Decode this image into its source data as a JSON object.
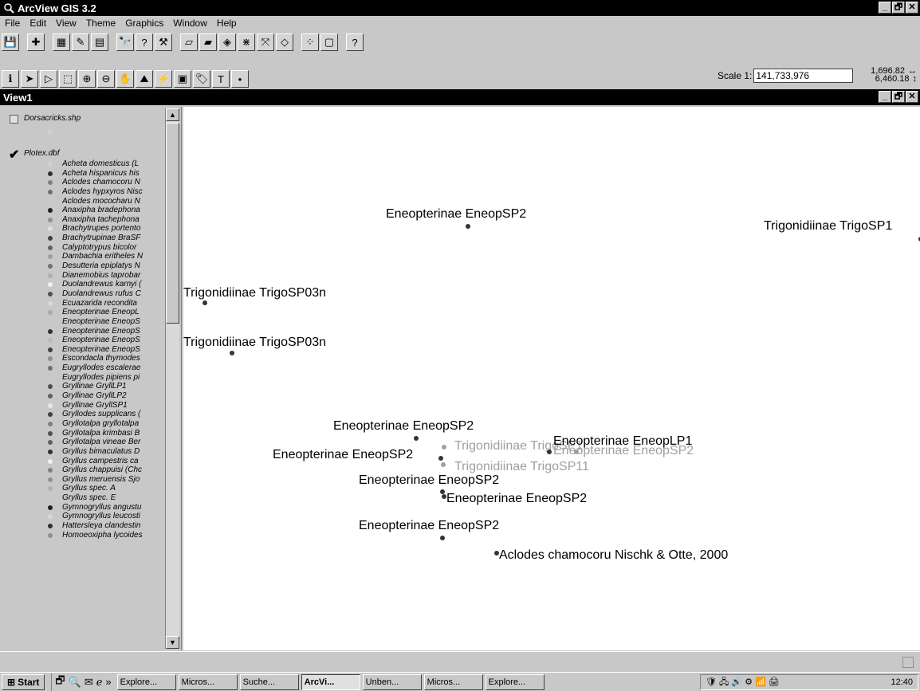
{
  "app": {
    "title": "ArcView GIS 3.2",
    "window_buttons": [
      "_",
      "🗗",
      "✕"
    ]
  },
  "menu": [
    "File",
    "Edit",
    "View",
    "Theme",
    "Graphics",
    "Window",
    "Help"
  ],
  "toolbar_buttons": [
    {
      "icon": "save-icon",
      "glyph": "💾"
    },
    {
      "icon": "add-theme-icon",
      "glyph": "✚"
    },
    {
      "icon": "theme-properties-icon",
      "glyph": "▦"
    },
    {
      "icon": "edit-legend-icon",
      "glyph": "✎"
    },
    {
      "icon": "open-table-icon",
      "glyph": "▤"
    },
    {
      "icon": "find-icon",
      "glyph": "🔭"
    },
    {
      "icon": "query-builder-icon",
      "glyph": "?"
    },
    {
      "icon": "locate-address-icon",
      "glyph": "⚒"
    },
    {
      "icon": "zoom-full-extent-icon",
      "glyph": "▱"
    },
    {
      "icon": "zoom-active-themes-icon",
      "glyph": "▰"
    },
    {
      "icon": "zoom-selected-icon",
      "glyph": "◈"
    },
    {
      "icon": "zoom-in-fixed-icon",
      "glyph": "⋇"
    },
    {
      "icon": "zoom-out-fixed-icon",
      "glyph": "⤧"
    },
    {
      "icon": "zoom-previous-icon",
      "glyph": "◇"
    },
    {
      "icon": "select-by-theme-icon",
      "glyph": "⁘"
    },
    {
      "icon": "clear-selection-icon",
      "glyph": "▢"
    },
    {
      "icon": "help-icon",
      "glyph": "?"
    }
  ],
  "tool_buttons": [
    {
      "icon": "identify-icon",
      "glyph": "ℹ"
    },
    {
      "icon": "pointer-icon",
      "glyph": "➤"
    },
    {
      "icon": "vertex-edit-icon",
      "glyph": "▷"
    },
    {
      "icon": "select-feature-icon",
      "glyph": "⬚"
    },
    {
      "icon": "zoom-in-icon",
      "glyph": "⊕"
    },
    {
      "icon": "zoom-out-icon",
      "glyph": "⊖"
    },
    {
      "icon": "pan-icon",
      "glyph": "✋"
    },
    {
      "icon": "measure-icon",
      "glyph": "⛰"
    },
    {
      "icon": "hot-link-icon",
      "glyph": "⚡"
    },
    {
      "icon": "area-of-interest-icon",
      "glyph": "▣"
    },
    {
      "icon": "label-icon",
      "glyph": "🏷"
    },
    {
      "icon": "text-icon",
      "glyph": "T"
    },
    {
      "icon": "draw-point-icon",
      "glyph": "•"
    }
  ],
  "scale": {
    "label": "Scale 1:",
    "value": "141,733,976"
  },
  "coords": {
    "x": "1,696.82",
    "y": "6,460.18"
  },
  "view": {
    "title": "View1"
  },
  "toc": {
    "theme1": {
      "name": "Dorsacricks.shp",
      "checked": false
    },
    "theme2": {
      "name": "Plotex.dbf",
      "checked": true
    },
    "legend": [
      {
        "label": "Acheta domesticus (L",
        "color": "#d0d0d0"
      },
      {
        "label": "Acheta hispanicus his",
        "color": "#303030"
      },
      {
        "label": "Aclodes chamocoru N",
        "color": "#808080"
      },
      {
        "label": "Aclodes hypxyros Nisc",
        "color": "#707070"
      },
      {
        "label": "Aclodes mococharu N",
        "color": "#c8c8c8"
      },
      {
        "label": "Anaxipha bradephona",
        "color": "#202020"
      },
      {
        "label": "Anaxipha tachephona",
        "color": "#909090"
      },
      {
        "label": "Brachytrupes portento",
        "color": "#e0e0e0"
      },
      {
        "label": "Brachytrupinae BraSF",
        "color": "#404040"
      },
      {
        "label": "Calyptotrypus bicolor",
        "color": "#606060"
      },
      {
        "label": "Dambachia eritheles N",
        "color": "#a0a0a0"
      },
      {
        "label": "Desutteria epiplatys N",
        "color": "#707070"
      },
      {
        "label": "Dianemobius taprobar",
        "color": "#b0b0b0"
      },
      {
        "label": "Duolandrewus karnyi (",
        "color": "#f0f0f0"
      },
      {
        "label": "Duolandrewus rufus C",
        "color": "#505050"
      },
      {
        "label": "Ecuazarida recondita",
        "color": "#d8d8d8"
      },
      {
        "label": "Eneopterinae EneopL",
        "color": "#a8a8a8"
      },
      {
        "label": "Eneopterinae EneopS",
        "color": "#c8c8c8"
      },
      {
        "label": "Eneopterinae EneopS",
        "color": "#303030"
      },
      {
        "label": "Eneopterinae EneopS",
        "color": "#b8b8b8"
      },
      {
        "label": "Eneopterinae EneopS",
        "color": "#404040"
      },
      {
        "label": "Escondacla thymodes",
        "color": "#909090"
      },
      {
        "label": "Eugryllodes escalerae",
        "color": "#707070"
      },
      {
        "label": "Eugryllodes pipiens pi",
        "color": "#c8c8c8"
      },
      {
        "label": "Gryllinae GryllLP1",
        "color": "#505050"
      },
      {
        "label": "Gryllinae GryllLP2",
        "color": "#606060"
      },
      {
        "label": "Gryllinae GryllSP1",
        "color": "#e8e8e8"
      },
      {
        "label": "Gryllodes supplicans (",
        "color": "#404040"
      },
      {
        "label": "Gryllotalpa gryllotalpa",
        "color": "#808080"
      },
      {
        "label": "Gryllotalpa krimbasi B",
        "color": "#505050"
      },
      {
        "label": "Gryllotalpa vineae Ber",
        "color": "#606060"
      },
      {
        "label": "Gryllus bimaculatus D",
        "color": "#303030"
      },
      {
        "label": "Gryllus campestris ca",
        "color": "#f0f0f0"
      },
      {
        "label": "Gryllus chappuisi (Chc",
        "color": "#808080"
      },
      {
        "label": "Gryllus meruensis Sjo",
        "color": "#909090"
      },
      {
        "label": "Gryllus spec. A",
        "color": "#b0b0b0"
      },
      {
        "label": "Gryllus spec. E",
        "color": "#c8c8c8"
      },
      {
        "label": "Gymnogryllus angustu",
        "color": "#202020"
      },
      {
        "label": "Gymnogryllus leucosti",
        "color": "#d8d8d8"
      },
      {
        "label": "Hattersleya clandestin",
        "color": "#303030"
      },
      {
        "label": "Homoeoxipha lycoides",
        "color": "#909090"
      }
    ]
  },
  "map_points": [
    {
      "label": "Eneopterinae EneopSP2",
      "grey": false
    },
    {
      "label": "Trigonidiinae TrigoSP1",
      "grey": false
    },
    {
      "label": "Trigonidiinae TrigoSP03n",
      "grey": false
    },
    {
      "label": "Trigonidiinae TrigoSP03n",
      "grey": false
    },
    {
      "label": "Eneopterinae EneopSP2",
      "grey": false
    },
    {
      "label": "Trigonidiinae TrigoSP1",
      "grey": true
    },
    {
      "label": "Eneopterinae EneopLP1",
      "grey": false
    },
    {
      "label": "Eneopterinae EneopSP2",
      "grey": true
    },
    {
      "label": "Eneopterinae EneopSP2",
      "grey": false
    },
    {
      "label": "Trigonidiinae TrigoSP11",
      "grey": true
    },
    {
      "label": "Eneopterinae EneopSP2",
      "grey": false
    },
    {
      "label": "Eneopterinae EneopSP2",
      "grey": false
    },
    {
      "label": "Eneopterinae EneopSP2",
      "grey": false
    },
    {
      "label": "Aclodes chamocoru Nischk & Otte, 2000",
      "grey": false
    }
  ],
  "taskbar": {
    "start": "Start",
    "quick_launch": [
      "show-desktop-icon",
      "explorer-icon",
      "outlook-icon",
      "ie-icon"
    ],
    "chevron": "»",
    "tasks": [
      {
        "label": "Explore...",
        "active": false
      },
      {
        "label": "Micros...",
        "active": false
      },
      {
        "label": "Suche...",
        "active": false
      },
      {
        "label": "ArcVi...",
        "active": true
      },
      {
        "label": "Unben...",
        "active": false
      },
      {
        "label": "Micros...",
        "active": false
      },
      {
        "label": "Explore...",
        "active": false
      }
    ],
    "clock": "12:40"
  }
}
